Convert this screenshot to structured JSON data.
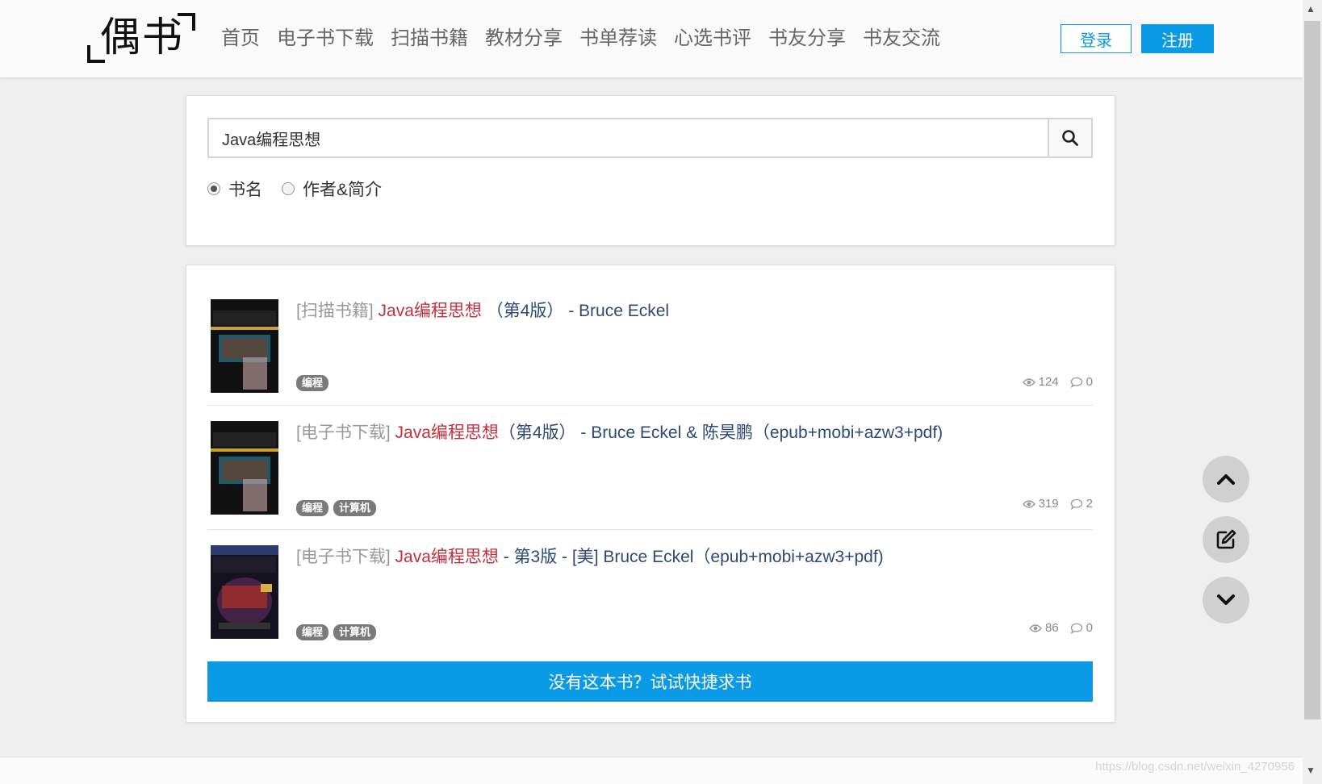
{
  "logo": {
    "text": "偶书"
  },
  "nav": [
    "首页",
    "电子书下载",
    "扫描书籍",
    "教材分享",
    "书单荐读",
    "心选书评",
    "书友分享",
    "书友交流"
  ],
  "auth": {
    "login": "登录",
    "register": "注册"
  },
  "search": {
    "value": "Java编程思想",
    "options": [
      {
        "label": "书名",
        "checked": true
      },
      {
        "label": "作者&简介",
        "checked": false
      }
    ]
  },
  "results": [
    {
      "category": "[扫描书籍]",
      "highlight": "Java编程思想",
      "rest": " （第4版） - Bruce Eckel",
      "tags": [
        "编程"
      ],
      "views": "124",
      "comments": "0"
    },
    {
      "category": "[电子书下载]",
      "highlight": "Java编程思想",
      "rest": "（第4版） - Bruce Eckel & 陈昊鹏（epub+mobi+azw3+pdf)",
      "tags": [
        "编程",
        "计算机"
      ],
      "views": "319",
      "comments": "2"
    },
    {
      "category": "[电子书下载]",
      "highlight": "Java编程思想",
      "rest": " - 第3版 - [美] Bruce Eckel（epub+mobi+azw3+pdf)",
      "tags": [
        "编程",
        "计算机"
      ],
      "views": "86",
      "comments": "0"
    }
  ],
  "request_button": "没有这本书？试试快捷求书",
  "watermark": "https://blog.csdn.net/weixin_4270956",
  "colors": {
    "accent": "#0a9ae6",
    "highlight": "#c6303e",
    "link": "#2c4a75"
  }
}
